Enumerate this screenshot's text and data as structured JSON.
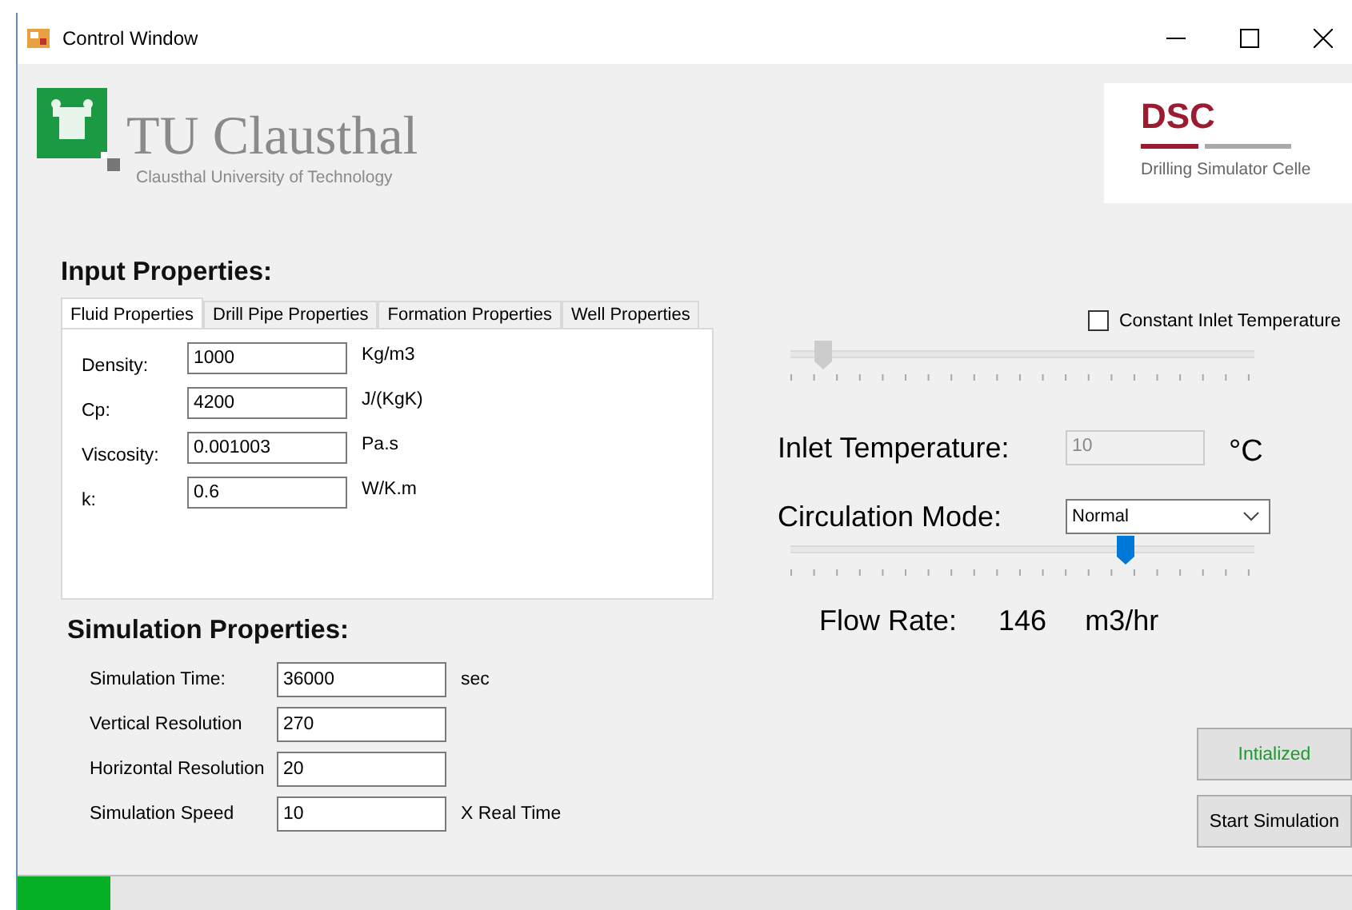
{
  "window": {
    "title": "Control Window"
  },
  "university_logo": {
    "name": "TU Clausthal",
    "subtitle": "Clausthal University of Technology"
  },
  "simulator_logo": {
    "name": "DSC",
    "subtitle": "Drilling Simulator Celle"
  },
  "input_properties": {
    "heading": "Input Properties:",
    "tabs": [
      {
        "label": "Fluid Properties",
        "selected": true
      },
      {
        "label": "Drill Pipe Properties",
        "selected": false
      },
      {
        "label": "Formation Properties",
        "selected": false
      },
      {
        "label": "Well Properties",
        "selected": false
      }
    ],
    "fields": [
      {
        "label": "Density:",
        "value": "1000",
        "unit": "Kg/m3"
      },
      {
        "label": "Cp:",
        "value": "4200",
        "unit": "J/(KgK)"
      },
      {
        "label": "Viscosity:",
        "value": "0.001003",
        "unit": "Pa.s"
      },
      {
        "label": "k:",
        "value": "0.6",
        "unit": "W/K.m"
      }
    ]
  },
  "simulation_properties": {
    "heading": "Simulation Properties:",
    "fields": [
      {
        "label": "Simulation Time:",
        "value": "36000",
        "unit": "sec"
      },
      {
        "label": "Vertical Resolution",
        "value": "270"
      },
      {
        "label": "Horizontal Resolution",
        "value": "20"
      },
      {
        "label": "Simulation Speed",
        "value": "10",
        "unit": "X Real Time"
      }
    ]
  },
  "constant_inlet_temperature": {
    "label": "Constant Inlet Temperature",
    "checked": false
  },
  "inlet_temperature_slider": {
    "level": 0.07,
    "disabled": true
  },
  "inlet_temperature": {
    "label": "Inlet Temperature:",
    "value": "10",
    "unit": "°C",
    "disabled": true
  },
  "circulation_mode": {
    "label": "Circulation Mode:",
    "value": "Normal"
  },
  "flow_rate_slider": {
    "level": 0.72
  },
  "flow_rate": {
    "label": "Flow Rate:",
    "value": "146",
    "unit": "m3/hr"
  },
  "buttons": [
    {
      "label": "Intialized",
      "kind": "status"
    },
    {
      "label": "Start Simulation",
      "kind": "action"
    }
  ],
  "progress": {
    "level": 0.07
  }
}
